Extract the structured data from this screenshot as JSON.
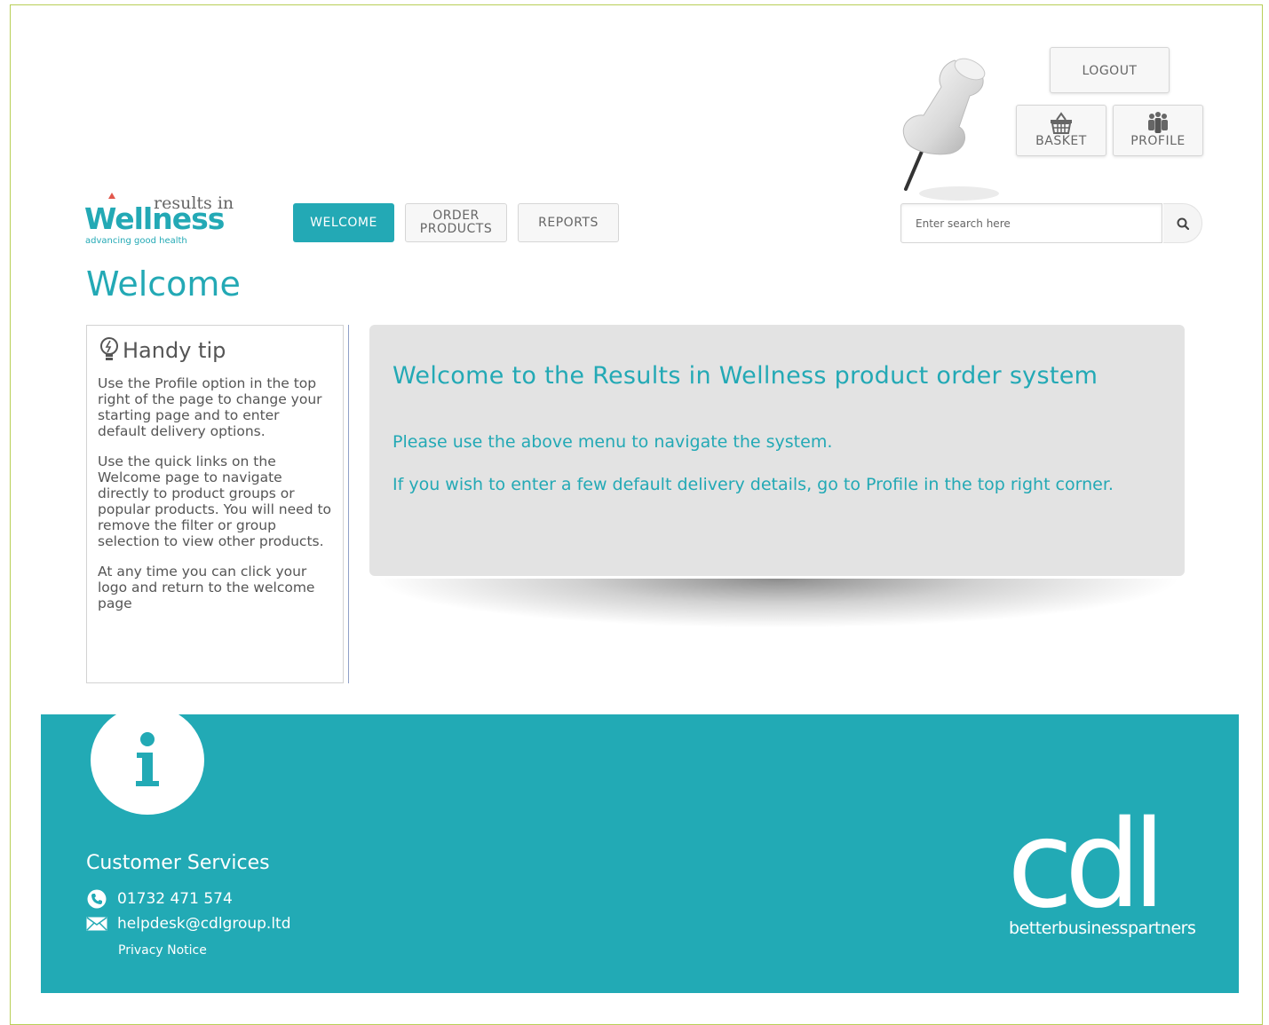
{
  "header": {
    "logout_label": "LOGOUT",
    "basket_label": "BASKET",
    "profile_label": "PROFILE",
    "pin_icon": "pushpin-image"
  },
  "logo": {
    "brand_top": "results in",
    "brand_main": "Wellness",
    "brand_tagline": "advancing good health"
  },
  "nav": {
    "items": [
      {
        "label": "WELCOME",
        "active": true
      },
      {
        "label_line1": "ORDER",
        "label_line2": "PRODUCTS",
        "active": false
      },
      {
        "label": "REPORTS",
        "active": false
      }
    ]
  },
  "search": {
    "placeholder": "Enter search here",
    "value": "",
    "icon": "search-icon"
  },
  "page": {
    "title": "Welcome"
  },
  "tip": {
    "title": "Handy tip",
    "paragraphs": [
      "Use the Profile option in the top right of the page to change your starting page and to enter default delivery options.",
      "Use the quick links on the Welcome page to navigate directly to product groups or popular products. You will need to remove the filter or group selection to view other products.",
      "At any time you can click your logo and return to the welcome page"
    ]
  },
  "welcome_panel": {
    "heading": "Welcome to the Results in Wellness product order system",
    "line1": "Please use the above menu to navigate the system.",
    "line2": "If you wish to enter a few default delivery details, go to Profile in the top right corner."
  },
  "footer": {
    "title": "Customer Services",
    "phone": "01732 471 574",
    "email": "helpdesk@cdlgroup.ltd",
    "privacy": "Privacy Notice",
    "partner_logo": "cdl",
    "partner_tagline": "betterbusinesspartners"
  },
  "colors": {
    "accent": "#23a9b5",
    "footer_bg": "#22aab5",
    "panel_bg": "#e3e3e3",
    "frame_border": "#b8cf57",
    "logo_red": "#e2574c"
  }
}
